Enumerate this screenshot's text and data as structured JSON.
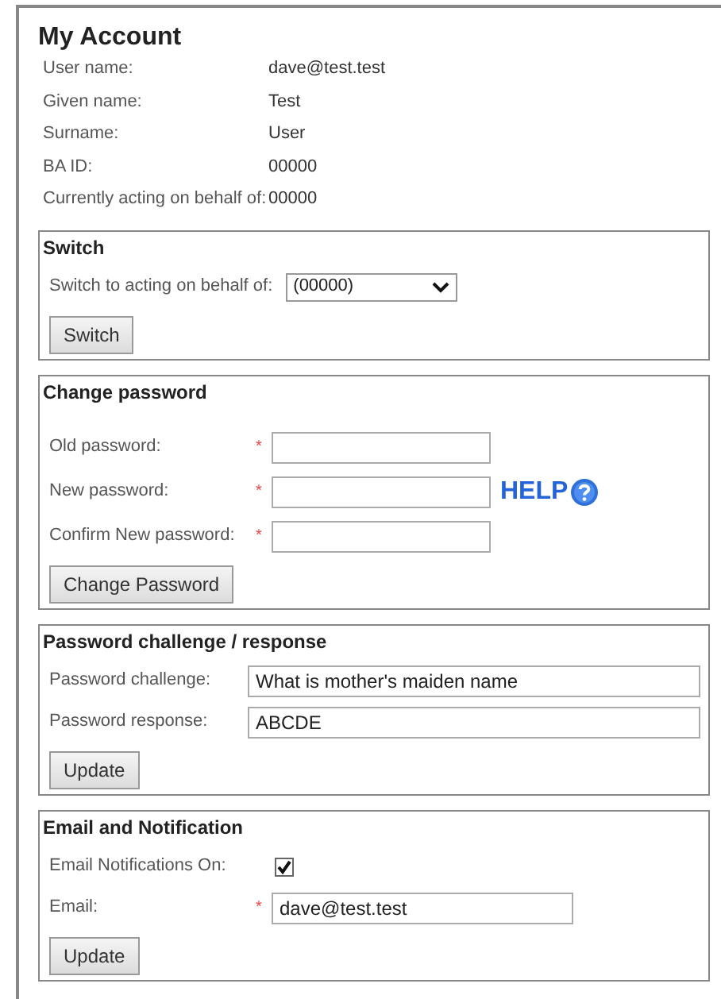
{
  "title": "My Account",
  "details": [
    {
      "label": "User name:",
      "value": "dave@test.test"
    },
    {
      "label": "Given name:",
      "value": "Test"
    },
    {
      "label": "Surname:",
      "value": "User"
    },
    {
      "label": "BA ID:",
      "value": "00000"
    },
    {
      "label": "Currently acting on behalf of:",
      "value": "00000"
    }
  ],
  "sections": [
    {
      "kind": "switch",
      "title": "Switch",
      "fields": [
        {
          "kind": "select",
          "label": "Switch to acting on behalf of:",
          "value": "(00000)"
        }
      ],
      "button": "Switch"
    },
    {
      "kind": "password",
      "title": "Change password",
      "fields": [
        {
          "kind": "password",
          "label": "Old password:",
          "marker": "*"
        },
        {
          "kind": "password",
          "label": "New password:",
          "marker": "*",
          "help": "HELP"
        },
        {
          "kind": "password",
          "label": "Confirm New password:",
          "marker": "*"
        }
      ],
      "button": "Change Password"
    },
    {
      "kind": "challenge",
      "title": "Password challenge / response",
      "fields": [
        {
          "kind": "text",
          "label": "Password challenge:",
          "value": "What is mother's maiden name"
        },
        {
          "kind": "text",
          "label": "Password response:",
          "value": "ABCDE"
        }
      ],
      "button": "Update"
    },
    {
      "kind": "notification",
      "title": "Email and Notification",
      "fields": [
        {
          "kind": "checkbox",
          "label": "Email Notifications On:",
          "checked": true
        },
        {
          "kind": "text",
          "label": "Email:",
          "value": "dave@test.test",
          "marker": "*"
        }
      ],
      "button": "Update"
    }
  ]
}
